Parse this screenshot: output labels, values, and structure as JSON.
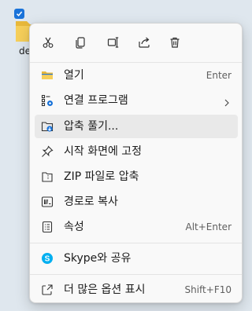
{
  "desktop": {
    "item_label": "de"
  },
  "toolbar": {
    "buttons": [
      {
        "icon": "cut-icon"
      },
      {
        "icon": "copy-icon"
      },
      {
        "icon": "rename-icon"
      },
      {
        "icon": "share-icon"
      },
      {
        "icon": "delete-icon"
      }
    ]
  },
  "menu": {
    "items": [
      {
        "label": "열기",
        "shortcut": "Enter",
        "icon": "folder-icon"
      },
      {
        "label": "연결 프로그램",
        "icon": "open-with-icon",
        "has_submenu": true
      },
      {
        "label": "압축 풀기...",
        "icon": "extract-icon",
        "highlighted": true
      },
      {
        "label": "시작 화면에 고정",
        "icon": "pin-icon"
      },
      {
        "label": "ZIP 파일로 압축",
        "icon": "zip-icon"
      },
      {
        "label": "경로로 복사",
        "icon": "copy-path-icon"
      },
      {
        "label": "속성",
        "shortcut": "Alt+Enter",
        "icon": "properties-icon"
      },
      {
        "label": "Skype와 공유",
        "icon": "skype-icon"
      },
      {
        "label": "더 많은 옵션 표시",
        "shortcut": "Shift+F10",
        "icon": "more-options-icon"
      }
    ]
  },
  "colors": {
    "accent": "#1a73d9",
    "folder": "#f4c84a",
    "hover": "#e9e9e9",
    "skype": "#00aff0"
  }
}
